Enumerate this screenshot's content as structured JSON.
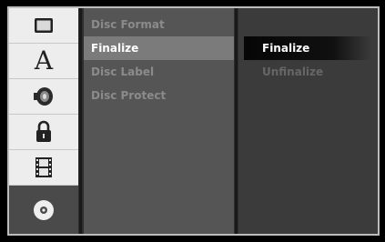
{
  "sidebar": {
    "icons": [
      {
        "name": "tv-display-icon"
      },
      {
        "name": "language-icon",
        "glyph": "A"
      },
      {
        "name": "audio-speaker-icon"
      },
      {
        "name": "lock-icon"
      },
      {
        "name": "film-recording-icon"
      },
      {
        "name": "disc-icon"
      }
    ]
  },
  "submenu": {
    "items": [
      {
        "label": "Disc Format"
      },
      {
        "label": "Finalize"
      },
      {
        "label": "Disc Label"
      },
      {
        "label": "Disc Protect"
      }
    ],
    "selected": "Finalize"
  },
  "options": {
    "items": [
      {
        "label": "Finalize"
      },
      {
        "label": "Unfinalize"
      }
    ],
    "selected": "Finalize"
  }
}
